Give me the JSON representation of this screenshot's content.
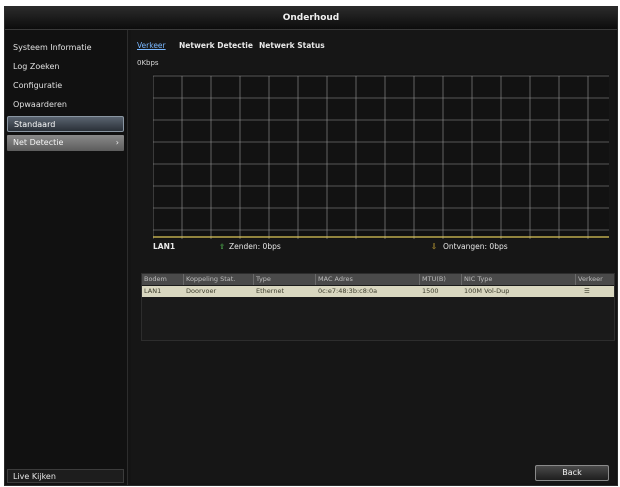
{
  "window": {
    "title": "Onderhoud"
  },
  "sidebar": {
    "items": [
      {
        "label": "Systeem Informatie"
      },
      {
        "label": "Log Zoeken"
      },
      {
        "label": "Configuratie"
      },
      {
        "label": "Opwaarderen"
      },
      {
        "label": "Standaard"
      },
      {
        "label": "Net Detectie",
        "chevron": "›"
      }
    ],
    "live_label": "Live Kijken"
  },
  "tabs": [
    {
      "label": "Verkeer",
      "active": true
    },
    {
      "label": "Netwerk Detectie",
      "active": false
    },
    {
      "label": "Netwerk Status",
      "active": false
    }
  ],
  "graph": {
    "unit": "0Kbps",
    "interface": "LAN1",
    "send_icon": "arrow-up-icon",
    "send_label": "Zenden: 0bps",
    "receive_icon": "arrow-down-icon",
    "receive_label": "Ontvangen: 0bps",
    "grid_color": "#c8c8c8",
    "line_color": "#e0c85a"
  },
  "table": {
    "headers": [
      "Bodem",
      "Koppeling Stat.",
      "Type",
      "MAC Adres",
      "MTU(B)",
      "NIC Type",
      "Verkeer"
    ],
    "rows": [
      [
        "LAN1",
        "Doorvoer",
        "Ethernet",
        "0c:e7:48:3b:c8:0a",
        "1500",
        "100M Vol-Dup",
        "☰"
      ]
    ]
  },
  "footer": {
    "back_label": "Back"
  }
}
